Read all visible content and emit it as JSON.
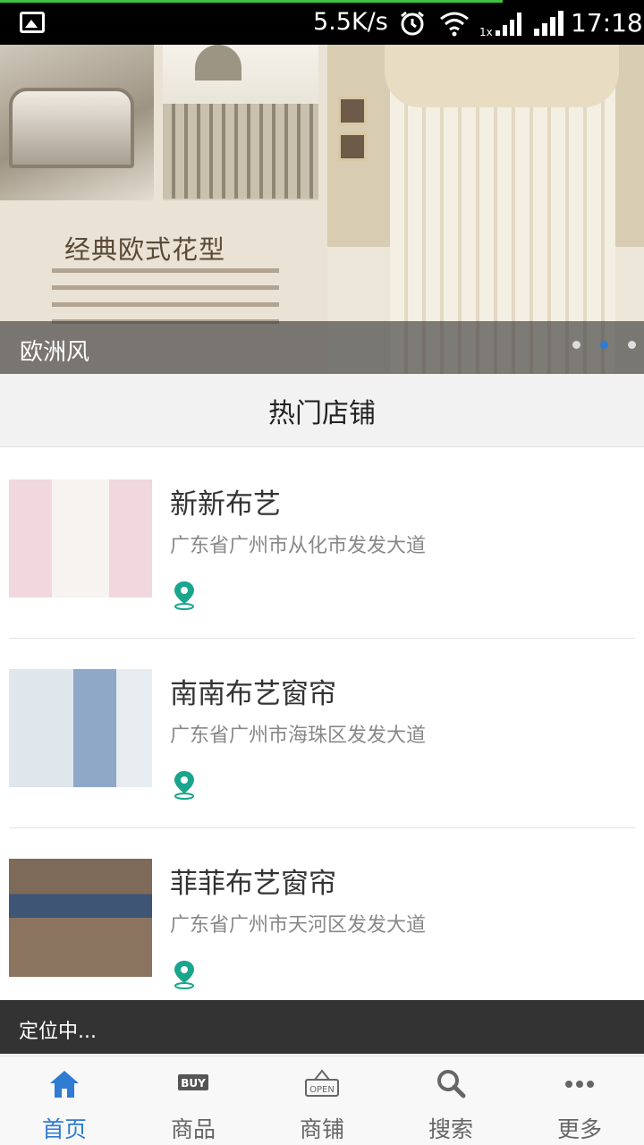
{
  "status_bar": {
    "net_speed": "5.5K/s",
    "time": "17:18",
    "icons": [
      "image-notification-icon",
      "alarm-icon",
      "wifi-icon",
      "signal-1x-icon",
      "signal-icon"
    ]
  },
  "banner": {
    "headline": "经典欧式花型",
    "caption": "欧洲风",
    "dots": 3,
    "active_dot": 2
  },
  "section": {
    "title": "热门店铺"
  },
  "shops": [
    {
      "name": "新新布艺",
      "address": "广东省广州市从化市发发大道",
      "icon": "location-pin-icon"
    },
    {
      "name": "南南布艺窗帘",
      "address": "广东省广州市海珠区发发大道",
      "icon": "location-pin-icon"
    },
    {
      "name": "菲菲布艺窗帘",
      "address": "广东省广州市天河区发发大道",
      "icon": "location-pin-icon"
    }
  ],
  "toast": {
    "text": "定位中..."
  },
  "tabbar": {
    "active": "home",
    "items": [
      {
        "id": "home",
        "label": "首页",
        "icon": "home-icon"
      },
      {
        "id": "goods",
        "label": "商品",
        "icon": "buy-icon"
      },
      {
        "id": "shops",
        "label": "商铺",
        "icon": "open-sign-icon"
      },
      {
        "id": "search",
        "label": "搜索",
        "icon": "search-icon"
      },
      {
        "id": "more",
        "label": "更多",
        "icon": "more-dots-icon"
      }
    ]
  },
  "colors": {
    "accent": "#2e7bd1",
    "pin": "#1aa58d",
    "toast_bg": "#333333"
  }
}
